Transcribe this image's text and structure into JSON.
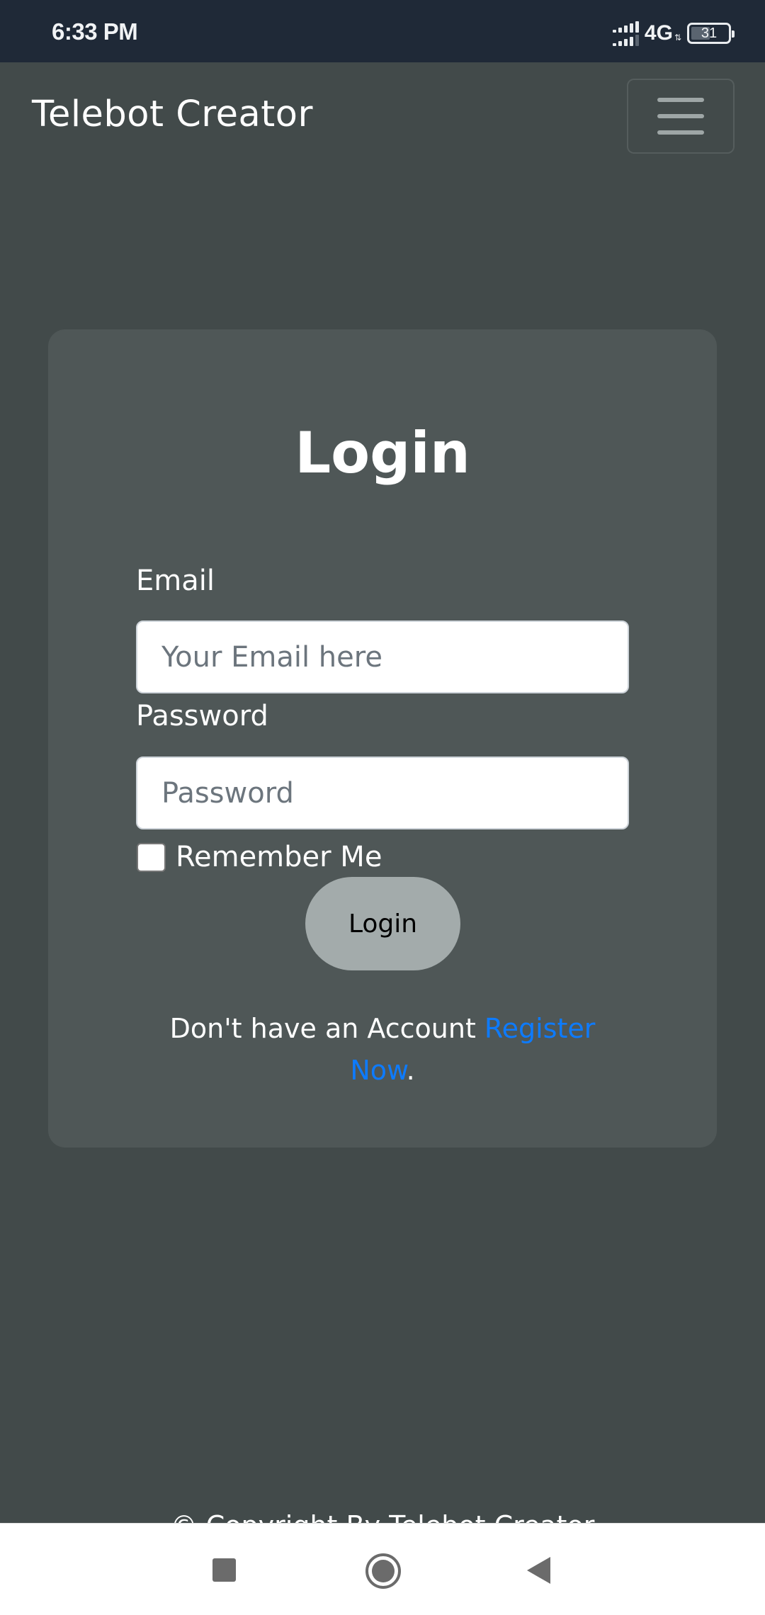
{
  "status_bar": {
    "time": "6:33 PM",
    "network": "4G",
    "battery_percent": 31,
    "battery_label": "31"
  },
  "navbar": {
    "brand": "Telebot Creator",
    "menu_icon": "hamburger-menu-icon"
  },
  "login_card": {
    "title": "Login",
    "email_label": "Email",
    "email_placeholder": "Your Email here",
    "email_value": "",
    "password_label": "Password",
    "password_placeholder": "Password",
    "password_value": "",
    "remember_label": "Remember Me",
    "remember_checked": false,
    "submit_label": "Login",
    "register_prompt": "Don't have an Account ",
    "register_link": "Register Now",
    "register_suffix": "."
  },
  "footer": {
    "text": "© Copyright By Telebot Creator"
  },
  "system_nav": {
    "recents_icon": "square-icon",
    "home_icon": "circle-icon",
    "back_icon": "triangle-back-icon"
  },
  "colors": {
    "page_bg": "#424a4a",
    "card_bg": "#4f5757",
    "status_bar_bg": "#1f2937",
    "button_bg": "#a3abab",
    "link": "#0d7bff"
  }
}
